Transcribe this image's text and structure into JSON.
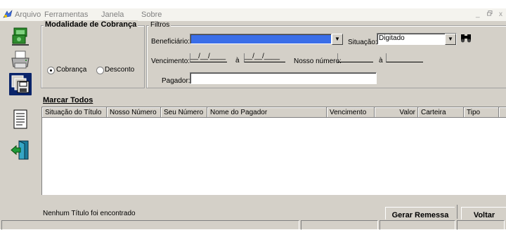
{
  "menu": {
    "items": [
      "Arquivo",
      "Ferramentas",
      "Janela",
      "Sobre"
    ],
    "window_controls": [
      "_",
      "á",
      "x"
    ]
  },
  "toolbar": {
    "buttons": [
      "money-icon",
      "printer-icon",
      "save-icon",
      "document-icon",
      "exit-icon"
    ]
  },
  "modalidade": {
    "title": "Modalidade de Cobrança",
    "options": [
      "Cobrança",
      "Desconto"
    ],
    "selected": "Cobrança"
  },
  "filtros": {
    "title": "Filtros",
    "beneficiario_label": "Beneficiário:",
    "situacao_label": "Situação:",
    "situacao_value": "Digitado",
    "vencimento_label": "Vencimento:",
    "date_placeholder": "__/__/____",
    "a_label": "à",
    "nosso_numero_label": "Nosso número:",
    "a2_label": "à",
    "pagador_label": "Pagador:"
  },
  "marcar_todos": "Marcar Todos",
  "grid": {
    "columns": [
      "Situação do Título",
      "Nosso Número",
      "Seu Número",
      "Nome do Pagador",
      "Vencimento",
      "Valor",
      "Carteira",
      "Tipo"
    ]
  },
  "status_text": "Nenhum Título foi encontrado",
  "buttons": {
    "gerar_remessa": "Gerar Remessa",
    "voltar": "Voltar"
  },
  "colors": {
    "face": "#d4d0c8",
    "selection": "#0a246a",
    "beneficiario_fill": "#3a6ee8"
  }
}
